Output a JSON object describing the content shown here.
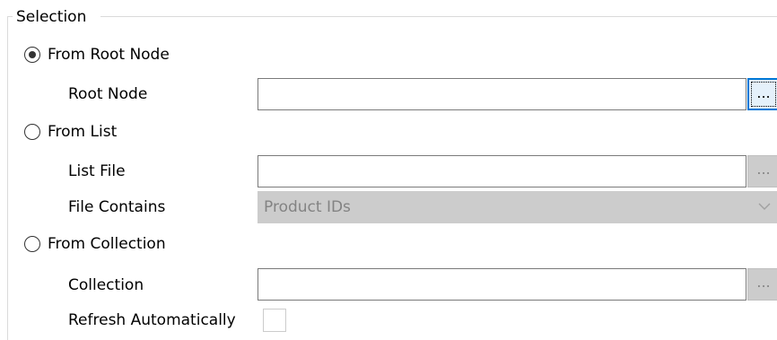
{
  "group": {
    "title": "Selection"
  },
  "options": {
    "root_node": {
      "label": "From Root Node",
      "selected": true,
      "field_label": "Root Node",
      "value": "",
      "browse_label": "..."
    },
    "list": {
      "label": "From List",
      "selected": false,
      "field_label": "List File",
      "value": "",
      "browse_label": "...",
      "contains_label": "File Contains",
      "contains_value": "Product IDs"
    },
    "collection": {
      "label": "From Collection",
      "selected": false,
      "field_label": "Collection",
      "value": "",
      "browse_label": "...",
      "refresh_label": "Refresh Automatically",
      "refresh_checked": false
    }
  },
  "icons": {
    "combo_arrow": "chevron-down-icon",
    "radio_dot": "radio-dot-icon"
  },
  "colors": {
    "focus_border": "#0078d7",
    "disabled_fill": "#cccccc",
    "disabled_text": "#838383"
  }
}
